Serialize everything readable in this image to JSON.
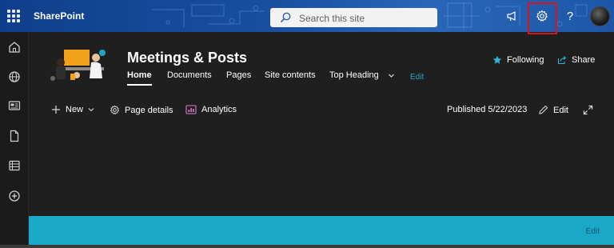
{
  "suite_bar": {
    "app_name": "SharePoint",
    "search_placeholder": "Search this site",
    "icons": [
      "waffle-icon",
      "megaphone-icon",
      "gear-icon",
      "help-icon",
      "avatar"
    ],
    "help_glyph": "?"
  },
  "left_rail": {
    "icons": [
      "home-icon",
      "globe-icon",
      "news-icon",
      "document-icon",
      "list-icon",
      "add-icon"
    ]
  },
  "site": {
    "title": "Meetings & Posts",
    "nav": [
      {
        "label": "Home"
      },
      {
        "label": "Documents"
      },
      {
        "label": "Pages"
      },
      {
        "label": "Site contents"
      },
      {
        "label": "Top Heading"
      },
      {
        "label": "Edit"
      }
    ],
    "following_label": "Following",
    "share_label": "Share"
  },
  "command_bar": {
    "new_label": "New",
    "page_details_label": "Page details",
    "analytics_label": "Analytics",
    "published_label": "Published 5/22/2023",
    "edit_label": "Edit"
  },
  "footer_band": {
    "edit_label": "Edit"
  },
  "colors": {
    "suite_bar": "#1a4fa0",
    "accent_teal": "#19a8c7",
    "nav_edit": "#23a9c9",
    "highlight_box": "#d9131b",
    "background": "#1f1f1f"
  }
}
